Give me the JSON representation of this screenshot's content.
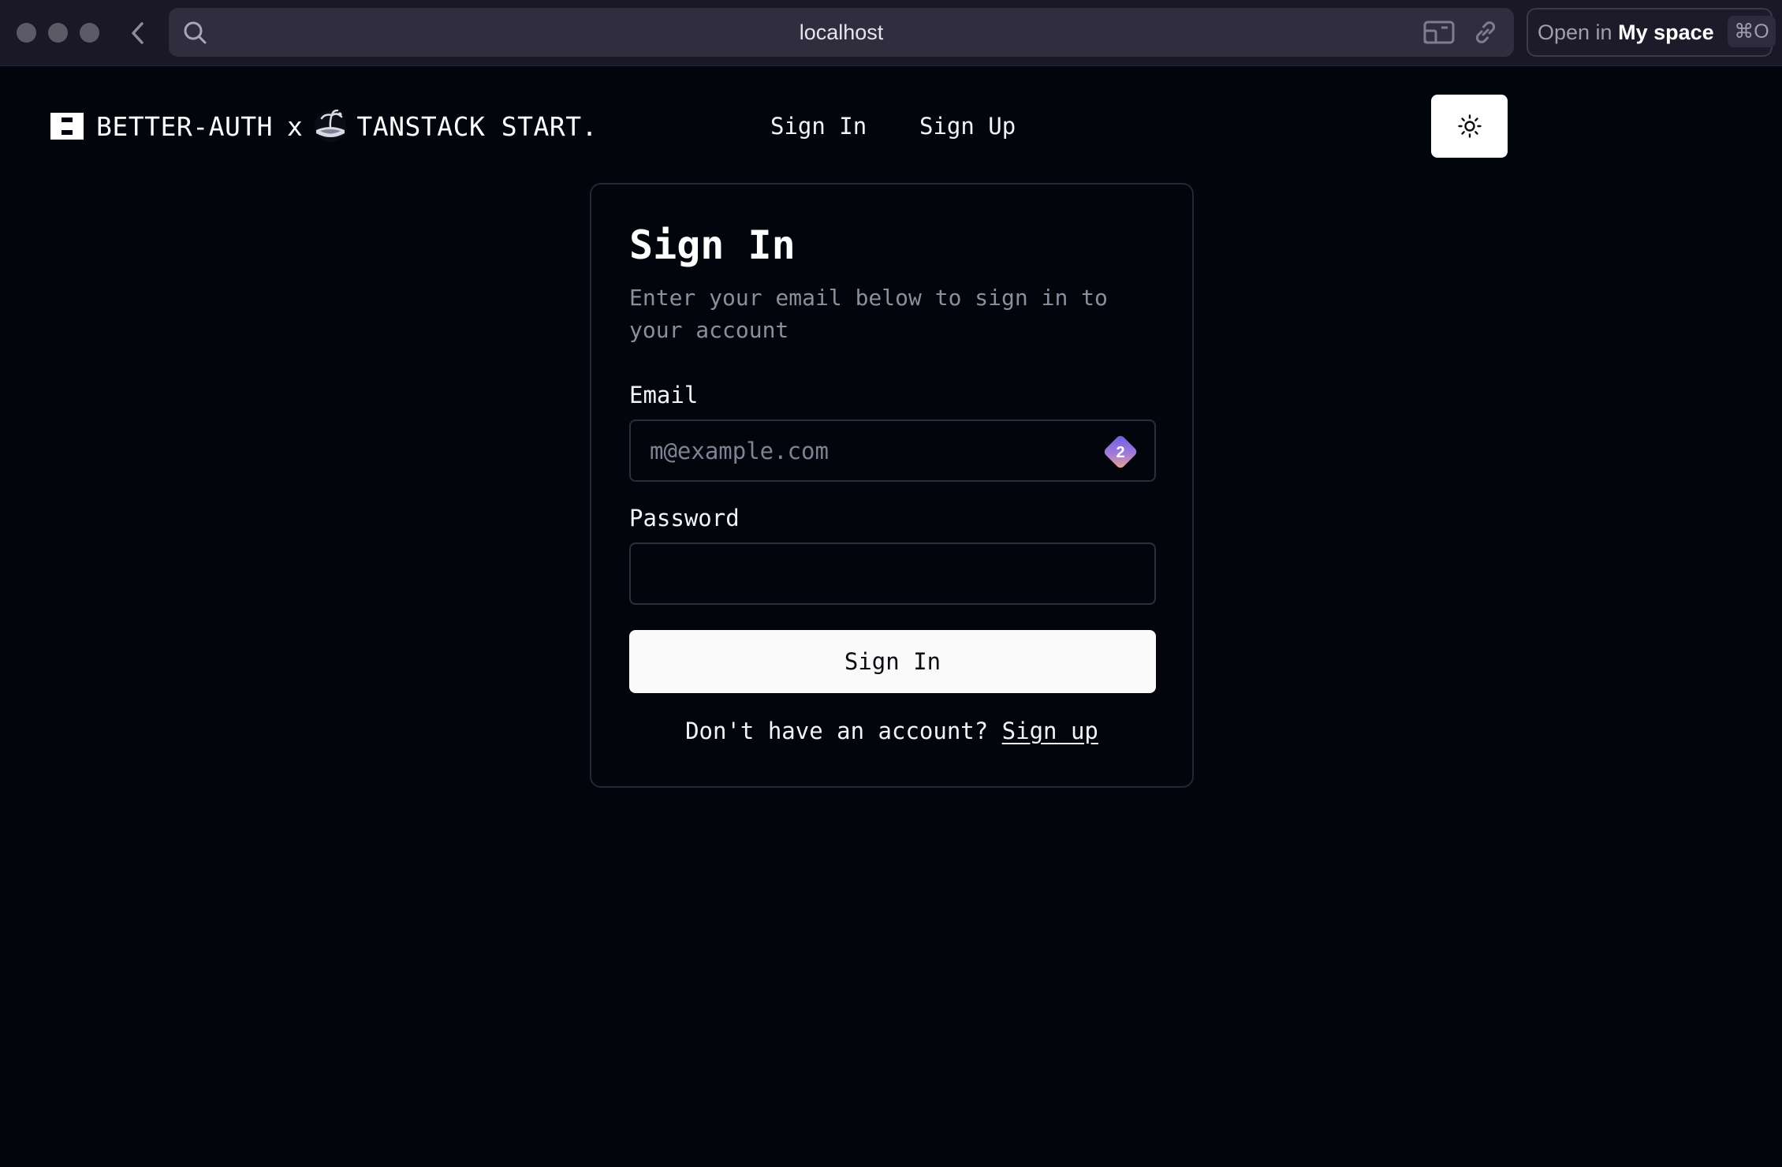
{
  "browser": {
    "url": "localhost",
    "open_in_muted": "Open in",
    "open_in_target": "My space",
    "open_in_shortcut": "⌘O"
  },
  "header": {
    "brand_left": "BETTER-AUTH",
    "brand_sep": "x",
    "brand_right": "TANSTACK START.",
    "nav": [
      {
        "label": "Sign In"
      },
      {
        "label": "Sign Up"
      }
    ]
  },
  "card": {
    "title": "Sign In",
    "description": "Enter your email below to sign in to your account",
    "email_label": "Email",
    "email_placeholder": "m@example.com",
    "password_manager_badge": "2",
    "password_label": "Password",
    "submit_label": "Sign In",
    "footer_text": "Don't have an account?",
    "footer_link": "Sign up"
  },
  "colors": {
    "page_bg": "#03050d",
    "card_border": "#232634",
    "button_bg": "#fafafa",
    "badge_gradient_start": "#6d5ce8",
    "badge_gradient_end": "#f0a58a"
  }
}
